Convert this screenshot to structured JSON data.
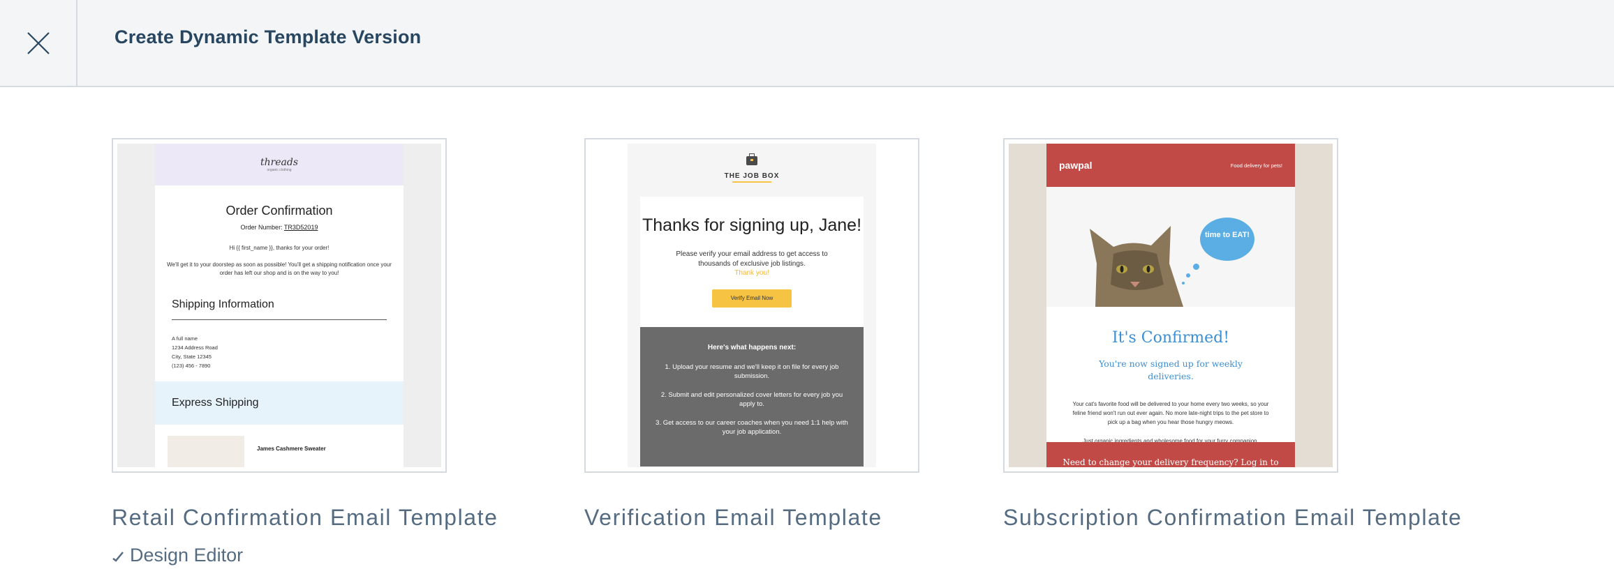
{
  "header": {
    "title": "Create Dynamic Template Version",
    "close_icon": "close-icon"
  },
  "cards": [
    {
      "title": "Retail Confirmation Email Template",
      "meta_icon": "check-icon",
      "meta_label": "Design Editor",
      "preview": {
        "logo": "threads",
        "logo_sub": "organic clothing",
        "heading": "Order Confirmation",
        "order_label": "Order Number:",
        "order_number": "TR3D52019",
        "greeting": "Hi {{ first_name }}, thanks for your order!",
        "message": "We'll get it to your doorstep as soon as possible! You'll get a shipping notification once your order has left our shop and is on the way to you!",
        "shipping_heading": "Shipping Information",
        "address": [
          "A full name",
          "1234 Address Road",
          "City, State 12345",
          "(123) 456 - 7890"
        ],
        "express": "Express Shipping",
        "item_name": "James Cashmere Sweater"
      }
    },
    {
      "title": "Verification Email Template",
      "preview": {
        "brand": "THE JOB BOX",
        "heading": "Thanks for signing up, Jane!",
        "message": "Please verify your email address to get access to thousands of exclusive job listings.",
        "thanks": "Thank you!",
        "button": "Verify Email Now",
        "next_heading": "Here's what happens next:",
        "steps": [
          "1. Upload your resume and we'll keep it on file for every job submission.",
          "2. Submit and edit personalized cover letters for every job you apply to.",
          "3. Get access to our career coaches when you need 1:1 help with your job application."
        ]
      }
    },
    {
      "title": "Subscription Confirmation Email Template",
      "preview": {
        "logo": "pawpal",
        "tagline": "Food delivery for pets!",
        "bubble": "time to EAT!",
        "heading": "It's Confirmed!",
        "subheading": "You're now signed up for weekly deliveries.",
        "body": "Your cat's favorite food will be delivered to your home every two weeks, so your feline friend won't run out ever again. No more late-night trips to the pet store to pick up a bag when you hear those hungry meows.",
        "body2": "Just organic ingredients and wholesome food for your furry companion.",
        "footer": "Need to change your delivery frequency? Log in to"
      }
    }
  ]
}
